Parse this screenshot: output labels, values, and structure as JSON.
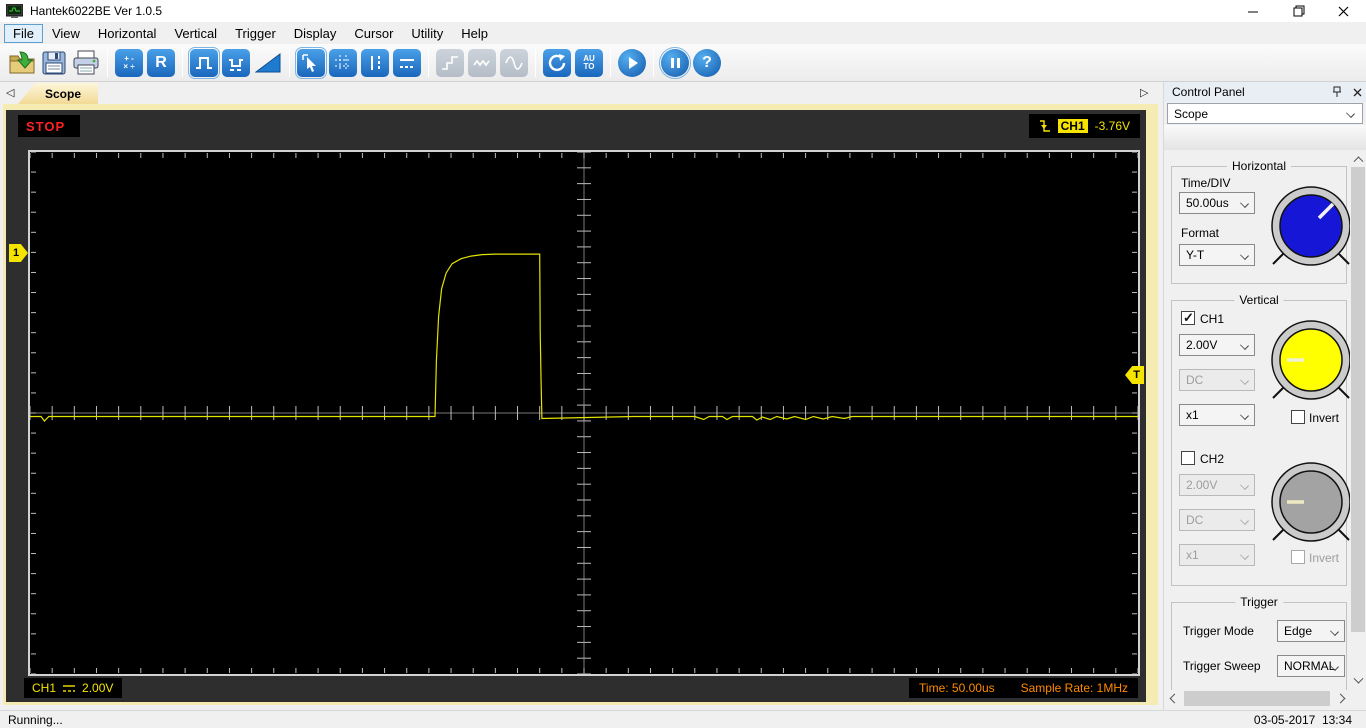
{
  "window": {
    "title": "Hantek6022BE Ver 1.0.5"
  },
  "menu": {
    "items": [
      "File",
      "View",
      "Horizontal",
      "Vertical",
      "Trigger",
      "Display",
      "Cursor",
      "Utility",
      "Help"
    ]
  },
  "toolbar": {
    "reference_label": "R",
    "auto_label_1": "AU",
    "auto_label_2": "TO",
    "math_row1": "+ -",
    "math_row2": "× ÷",
    "help_label": "?",
    "buttons": [
      "open-file",
      "save",
      "print",
      "math",
      "reference",
      "pulse-trigger",
      "pulse-width-trigger",
      "ramp",
      "cursor-select",
      "grid",
      "vertical-cursors",
      "horizontal-cursors",
      "step-wave",
      "noise-wave",
      "sine-wave",
      "refresh",
      "auto-set",
      "start",
      "pause",
      "help"
    ],
    "selected": [
      "pulse-trigger",
      "cursor-select",
      "pause"
    ],
    "disabled": [
      "step-wave",
      "noise-wave",
      "sine-wave"
    ]
  },
  "tabs": {
    "scope_label": "Scope"
  },
  "scope": {
    "run_state": "STOP",
    "trigger_readout": {
      "channel": "CH1",
      "level": "-3.76V"
    },
    "left_marker": "1",
    "right_marker": "T",
    "channel_readout": {
      "channel": "CH1",
      "scale": "2.00V"
    },
    "time_readout": "Time: 50.00us",
    "sample_rate_readout": "Sample Rate: 1MHz",
    "grid": {
      "edge_ticks_x": 50,
      "edge_ticks_y": 26,
      "center_ticks_x": 50,
      "center_ticks_y": 33
    }
  },
  "waveform": {
    "color": "#e3e300",
    "points": [
      [
        0.0,
        0.5067
      ],
      [
        0.01,
        0.5067
      ],
      [
        0.013,
        0.5155
      ],
      [
        0.017,
        0.5067
      ],
      [
        0.36,
        0.5067
      ],
      [
        0.3655,
        0.5067
      ],
      [
        0.3668,
        0.4
      ],
      [
        0.3688,
        0.315
      ],
      [
        0.3715,
        0.262
      ],
      [
        0.3755,
        0.232
      ],
      [
        0.381,
        0.214
      ],
      [
        0.389,
        0.2045
      ],
      [
        0.398,
        0.1995
      ],
      [
        0.408,
        0.1965
      ],
      [
        0.42,
        0.1955
      ],
      [
        0.46,
        0.1955
      ],
      [
        0.4605,
        0.345
      ],
      [
        0.4612,
        0.432
      ],
      [
        0.462,
        0.5105
      ],
      [
        0.545,
        0.5067
      ],
      [
        0.6,
        0.5067
      ],
      [
        0.608,
        0.5125
      ],
      [
        0.613,
        0.5067
      ],
      [
        0.625,
        0.5067
      ],
      [
        0.629,
        0.5125
      ],
      [
        0.634,
        0.5067
      ],
      [
        0.652,
        0.5067
      ],
      [
        0.656,
        0.5135
      ],
      [
        0.661,
        0.5077
      ],
      [
        0.668,
        0.5125
      ],
      [
        0.674,
        0.5067
      ],
      [
        0.683,
        0.5115
      ],
      [
        0.69,
        0.5067
      ],
      [
        0.7,
        0.5125
      ],
      [
        0.707,
        0.5067
      ],
      [
        0.716,
        0.5115
      ],
      [
        0.724,
        0.5067
      ],
      [
        0.735,
        0.5105
      ],
      [
        0.742,
        0.5067
      ],
      [
        0.76,
        0.5067
      ],
      [
        1.0,
        0.5067
      ]
    ]
  },
  "panel": {
    "title": "Control Panel",
    "mode_selector": "Scope",
    "horizontal": {
      "legend": "Horizontal",
      "time_div_label": "Time/DIV",
      "time_div_value": "50.00us",
      "format_label": "Format",
      "format_value": "Y-T",
      "knob_color": "#1616d6"
    },
    "vertical": {
      "legend": "Vertical",
      "ch1": {
        "label": "CH1",
        "checked": true,
        "volts_value": "2.00V",
        "coupling_value": "DC",
        "probe_value": "x1",
        "invert_label": "Invert",
        "knob_color": "#ffff00"
      },
      "ch2": {
        "label": "CH2",
        "checked": false,
        "volts_value": "2.00V",
        "coupling_value": "DC",
        "probe_value": "x1",
        "invert_label": "Invert",
        "knob_color": "#a3a3a3"
      }
    },
    "trigger": {
      "legend": "Trigger",
      "mode_label": "Trigger Mode",
      "mode_value": "Edge",
      "sweep_label": "Trigger Sweep",
      "sweep_value": "NORMAL"
    }
  },
  "status": {
    "left": "Running...",
    "right": "03-05-2017  13:34"
  }
}
